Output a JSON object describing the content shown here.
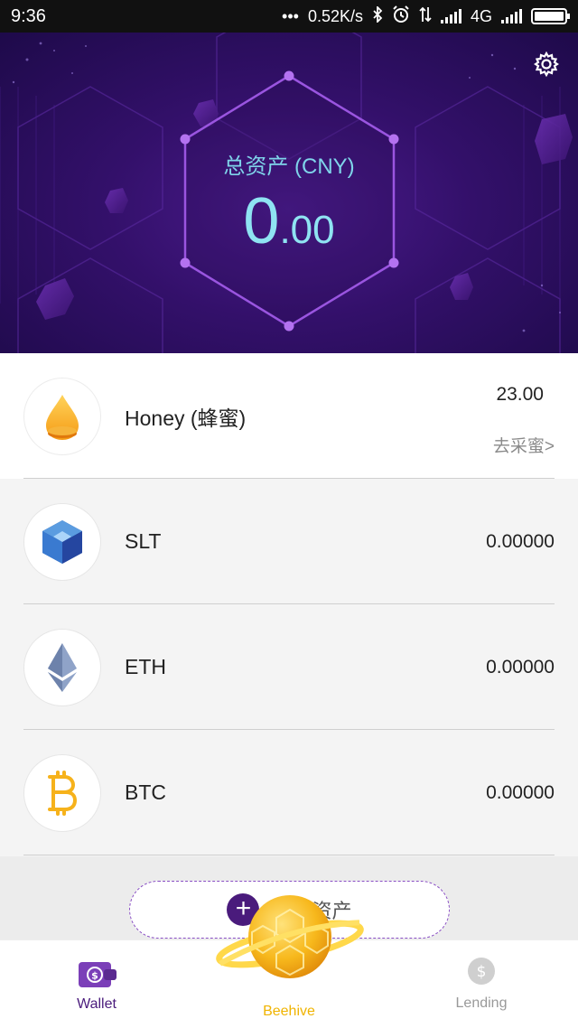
{
  "status_bar": {
    "time": "9:36",
    "dots": "•••",
    "speed": "0.52K/s",
    "network": "4G",
    "icons": [
      "bluetooth-icon",
      "alarm-icon",
      "data-arrows-icon",
      "signal-icon",
      "signal-icon",
      "battery-icon"
    ]
  },
  "header": {
    "total_label": "总资产 (CNY)",
    "total_int": "0",
    "total_dec": ".00",
    "settings_icon": "gear-icon"
  },
  "assets": [
    {
      "name": "Honey (蜂蜜)",
      "amount": "23.00",
      "action": "去采蜜>",
      "icon": "honey-drop-icon",
      "color": "#f7a928"
    },
    {
      "name": "SLT",
      "amount": "0.00000",
      "icon": "slt-cube-icon",
      "color": "#3a6fc8"
    },
    {
      "name": "ETH",
      "amount": "0.00000",
      "icon": "eth-icon",
      "color": "#7b8fb5"
    },
    {
      "name": "BTC",
      "amount": "0.00000",
      "icon": "btc-icon",
      "color": "#f6b21b"
    }
  ],
  "add_asset": {
    "label": "添加资产",
    "icon": "plus-icon"
  },
  "nav": {
    "wallet": "Wallet",
    "beehive": "Beehive",
    "lending": "Lending"
  },
  "colors": {
    "brand_purple": "#4a1b7c",
    "accent_cyan": "#8fe3f2",
    "beehive_gold": "#f0b400"
  }
}
